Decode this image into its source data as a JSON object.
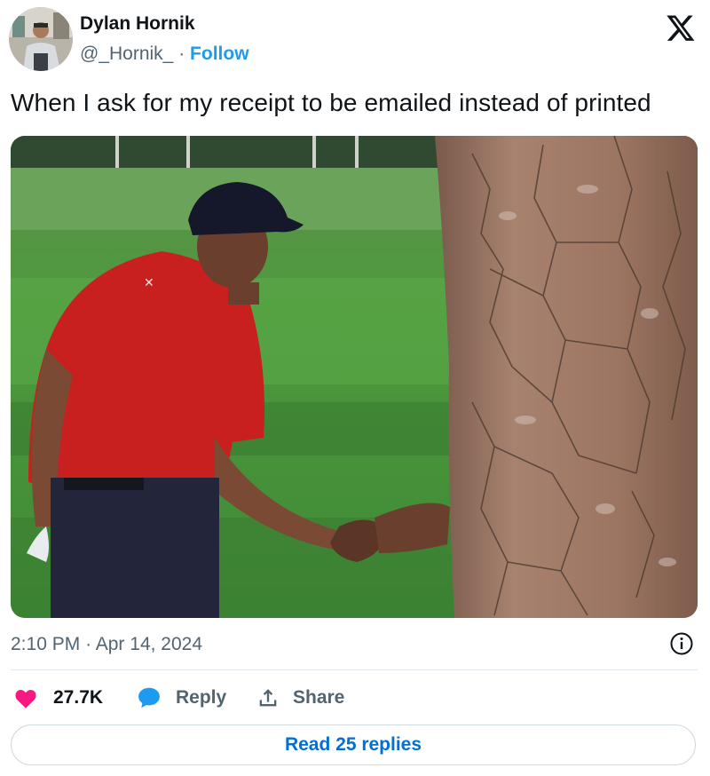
{
  "author": {
    "name": "Dylan Hornik",
    "handle": "@_Hornik_",
    "separator": "·",
    "follow_label": "Follow"
  },
  "tweet": {
    "text": "When I ask for my receipt to be emailed instead of printed"
  },
  "meta": {
    "time": "2:10 PM",
    "separator": "·",
    "date": "Apr 14, 2024"
  },
  "actions": {
    "like_count": "27.7K",
    "reply_label": "Reply",
    "share_label": "Share"
  },
  "read_replies_label": "Read 25 replies",
  "colors": {
    "accent": "#1d9bf0",
    "like": "#f91880",
    "reply": "#1d9bf0",
    "link": "#006fd6",
    "muted": "#536471"
  },
  "icons": [
    "x-logo-icon",
    "info-icon",
    "heart-icon",
    "reply-bubble-icon",
    "share-icon"
  ]
}
